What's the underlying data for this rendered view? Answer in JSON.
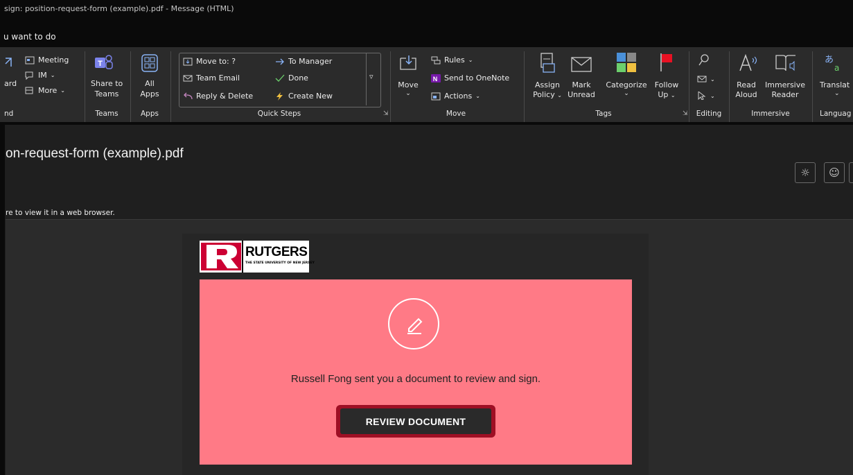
{
  "window": {
    "title": "sign: position-request-form (example).pdf  -  Message (HTML)",
    "tell_me": "u want to do"
  },
  "ribbon": {
    "respond_partial": {
      "label1": "ard",
      "group": "nd"
    },
    "respond_extra": {
      "meeting": "Meeting",
      "im": "IM",
      "more": "More"
    },
    "teams": {
      "share_label1": "Share to",
      "share_label2": "Teams",
      "group": "Teams"
    },
    "apps": {
      "label1": "All",
      "label2": "Apps",
      "group": "Apps"
    },
    "quick_steps": {
      "items": [
        "Move to: ?",
        "To Manager",
        "Team Email",
        "Done",
        "Reply & Delete",
        "Create New"
      ],
      "group": "Quick Steps"
    },
    "move": {
      "move_label": "Move",
      "rules": "Rules",
      "onenote": "Send to OneNote",
      "actions": "Actions",
      "group": "Move"
    },
    "tags": {
      "assign1": "Assign",
      "assign2": "Policy",
      "mark1": "Mark",
      "mark2": "Unread",
      "categorize": "Categorize",
      "follow1": "Follow",
      "follow2": "Up",
      "group": "Tags"
    },
    "editing": {
      "group": "Editing"
    },
    "immersive": {
      "read1": "Read",
      "read2": "Aloud",
      "imm1": "Immersive",
      "imm2": "Reader",
      "group": "Immersive"
    },
    "language": {
      "translate": "Translat",
      "group": "Languag"
    }
  },
  "message": {
    "subject": "on-request-form (example).pdf",
    "infobar": "re to view it in a web browser."
  },
  "email": {
    "logo_text": "RUTGERS",
    "logo_sub": "THE STATE UNIVERSITY OF NEW JERSEY",
    "body_text": "Russell Fong sent you a document to review and sign.",
    "button_label": "REVIEW DOCUMENT",
    "accent_color": "#ff7a86",
    "button_border_color": "#9e0f24"
  }
}
